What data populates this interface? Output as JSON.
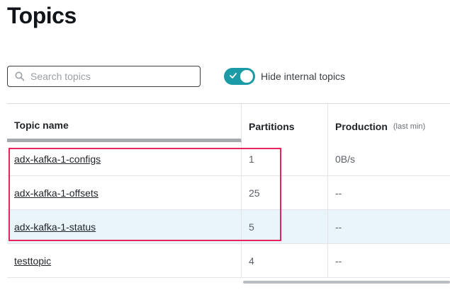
{
  "page": {
    "title": "Topics"
  },
  "search": {
    "placeholder": "Search topics",
    "value": ""
  },
  "toggle": {
    "label": "Hide internal topics",
    "on": true
  },
  "table": {
    "columns": {
      "name": "Topic name",
      "partitions": "Partitions",
      "production": "Production",
      "production_sub": "(last min)"
    },
    "rows": [
      {
        "name": "adx-kafka-1-configs",
        "partitions": "1",
        "production": "0B/s"
      },
      {
        "name": "adx-kafka-1-offsets",
        "partitions": "25",
        "production": "--"
      },
      {
        "name": "adx-kafka-1-status",
        "partitions": "5",
        "production": "--"
      },
      {
        "name": "testtopic",
        "partitions": "4",
        "production": "--"
      }
    ]
  },
  "colors": {
    "accent": "#1a9ba6",
    "annotation_box": "#e8245a",
    "highlight_row": "#e9f5fb"
  }
}
